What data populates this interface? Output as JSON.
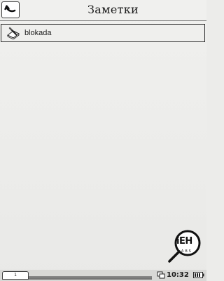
{
  "window": {
    "title": "Заметки"
  },
  "header": {
    "back_icon": "back-arrow-icon"
  },
  "notes": {
    "items": [
      {
        "label": "blokada",
        "icon": "note-icon"
      }
    ]
  },
  "watermark": {
    "word": "iEH",
    "sub": "LABS"
  },
  "statusbar": {
    "page_indicator": "1",
    "time": "10:32",
    "sync_icon": "sync-icon",
    "battery_icon": "battery-icon"
  }
}
